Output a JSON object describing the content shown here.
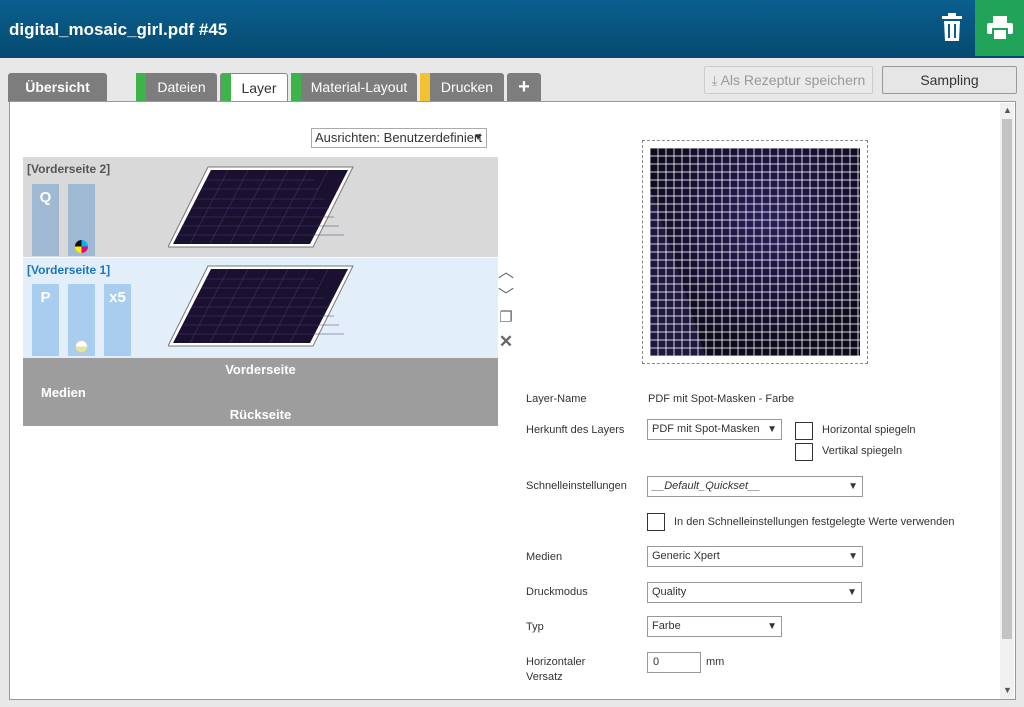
{
  "header": {
    "title": "digital_mosaic_girl.pdf #45",
    "icons": {
      "delete": "trash-icon",
      "print": "printer-icon"
    },
    "colors": {
      "bar": "#0a5f8e",
      "print_button": "#21a35a"
    }
  },
  "tabs": [
    {
      "label": "Übersicht",
      "stripe": ""
    },
    {
      "label": "Dateien",
      "stripe": "#3cb44a"
    },
    {
      "label": "Layer",
      "stripe": "#3cb44a"
    },
    {
      "label": "Material-Layout",
      "stripe": "#3cb44a"
    },
    {
      "label": "Drucken",
      "stripe": "#f2c232"
    },
    {
      "label": "+",
      "stripe": ""
    }
  ],
  "toolbar": {
    "save_recipe_label": "Als Rezeptur speichern",
    "sampling_label": "Sampling"
  },
  "layers_panel": {
    "align_select": "Ausrichten: Benutzerdefiniert",
    "layers": [
      {
        "name": "[Vorderseite 2]",
        "chips": [
          "Q",
          ""
        ],
        "selected": false
      },
      {
        "name": "[Vorderseite 1]",
        "chips": [
          "P",
          "",
          "x5"
        ],
        "selected": true
      }
    ],
    "media": {
      "label": "Medien",
      "front": "Vorderseite",
      "back": "Rückseite"
    }
  },
  "form": {
    "layer_name_label": "Layer-Name",
    "layer_name_value": "PDF mit Spot-Masken - Farbe",
    "origin_label": "Herkunft des Layers",
    "origin_value": "PDF mit Spot-Masken",
    "mirror_h_label": "Horizontal spiegeln",
    "mirror_v_label": "Vertikal spiegeln",
    "quick_label": "Schnelleinstellungen",
    "quick_value": "__Default_Quickset__",
    "quick_use_label": "In den Schnelleinstellungen festgelegte Werte verwenden",
    "media_label": "Medien",
    "media_value": "Generic Xpert",
    "mode_label": "Druckmodus",
    "mode_value": "Quality",
    "type_label": "Typ",
    "type_value": "Farbe",
    "hoffset_label_1": "Horizontaler",
    "hoffset_label_2": "Versatz",
    "hoffset_value": "0",
    "hoffset_unit": "mm"
  }
}
